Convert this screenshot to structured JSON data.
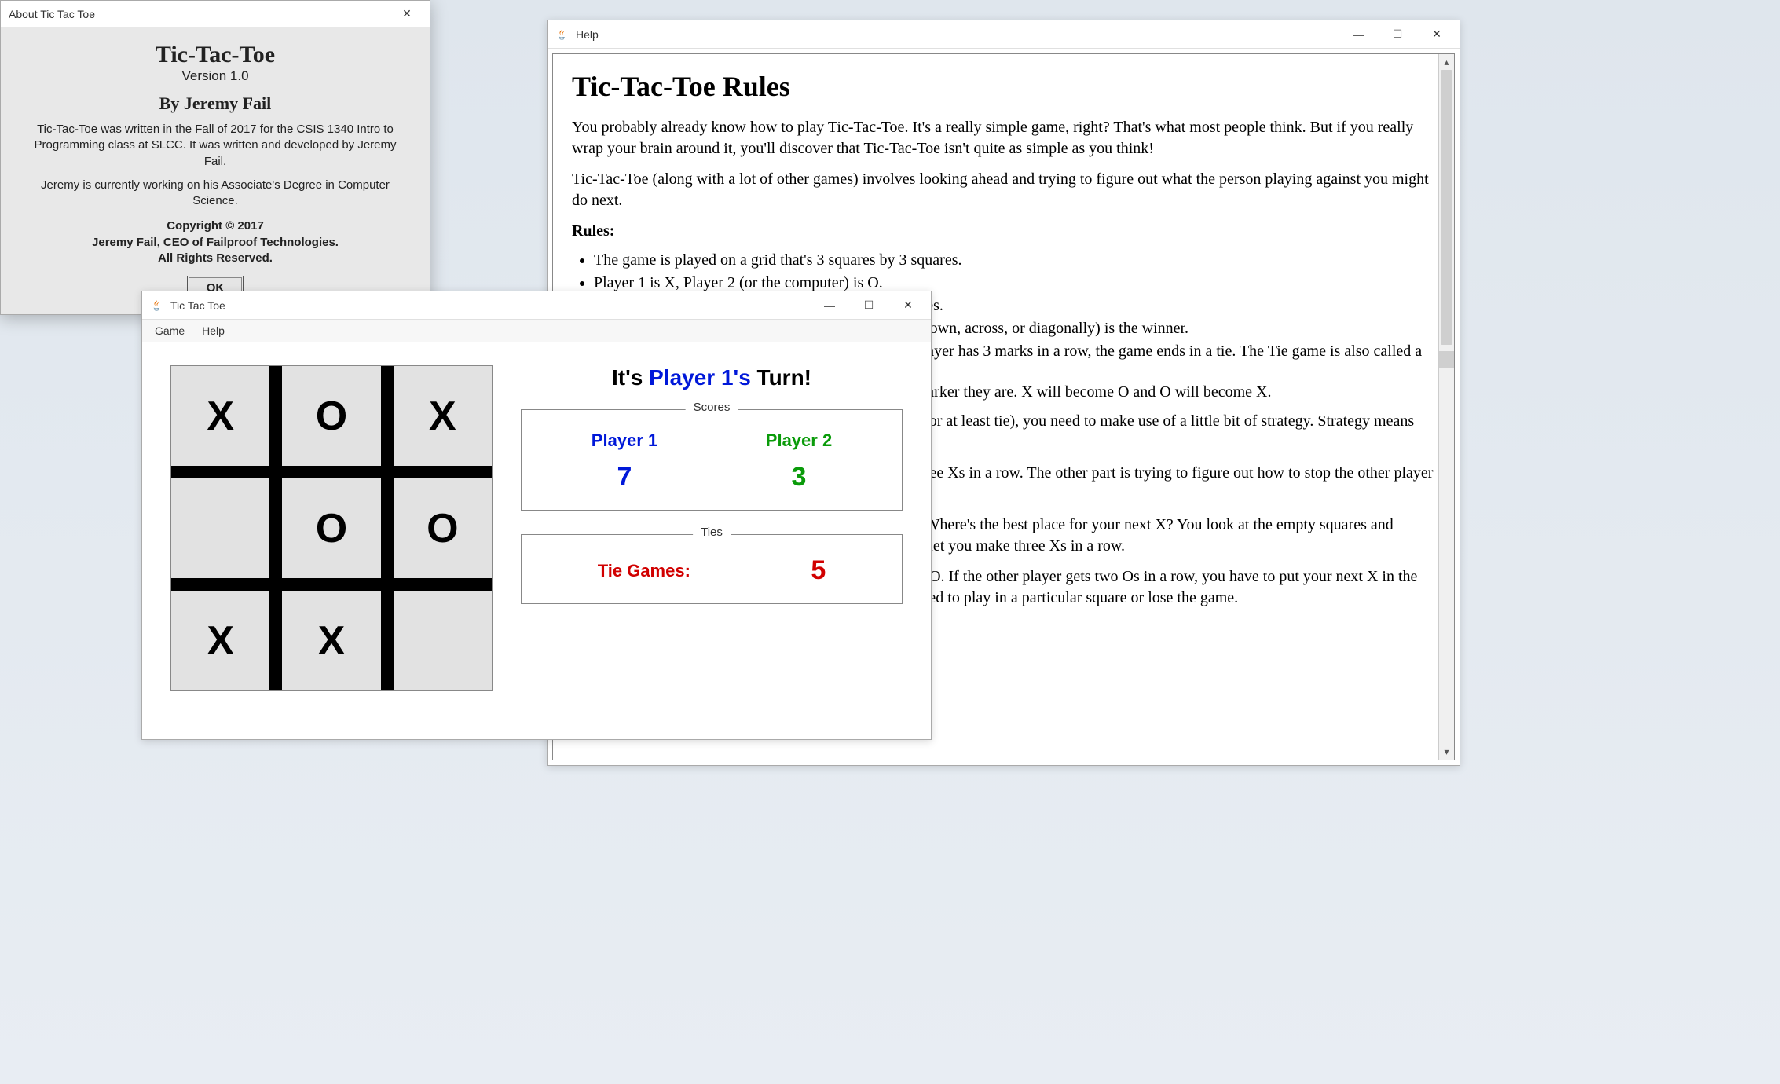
{
  "help_window": {
    "title": "Help",
    "heading": "Tic-Tac-Toe Rules",
    "p1": "You probably already know how to play Tic-Tac-Toe. It's a really simple game, right? That's what most people think. But if you really wrap your brain around it, you'll discover that Tic-Tac-Toe isn't quite as simple as you think!",
    "p2": "Tic-Tac-Toe (along with a lot of other games) involves looking ahead and trying to figure out what the person playing against you might do next.",
    "rules_label": "Rules:",
    "rules": [
      "The game is played on a grid that's 3 squares by 3 squares.",
      "Player 1 is X, Player 2 (or the computer) is O.",
      "Players take turns putting their marks in empty squares.",
      "The first player to get 3 of their marks in a row (up, down, across, or diagonally) is the winner.",
      "When all 9 squares are full, the game is over. If no player has 3 marks in a row, the game ends in a tie. The Tie game is also called a Cat Game.",
      "At the end of each game, the players will swap the marker they are. X will become O and O will become X."
    ],
    "strategy_p1": "Part of your strategy is trying to figure out how to get three Xs in a row. The other part is trying to figure out how to stop the other player from getting three Os in a row.",
    "strategy_p2": "After you put an X in a square, you start looking ahead. Where's the best place for your next X? You look at the empty squares and decide which ones are good choices—which ones might let you make three Xs in a row.",
    "strategy_p3": "You also have to watch where the other player puts their O. If the other player gets two Os in a row, you have to put your next X in the last empty square in that row, or they'll win. You are forced to play in a particular square or lose the game.",
    "strategy_intro": "How can I win at Tic-Tac-Toe? To beat the other player (or at least tie), you need to make use of a little bit of strategy. Strategy means figuring out what you need to do to win."
  },
  "game_window": {
    "title": "Tic Tac Toe",
    "menus": {
      "game": "Game",
      "help": "Help"
    },
    "turn_prefix": "It's ",
    "turn_player": "Player 1's",
    "turn_suffix": " Turn!",
    "scores_legend": "Scores",
    "ties_legend": "Ties",
    "p1_label": "Player 1",
    "p2_label": "Player 2",
    "p1_score": "7",
    "p2_score": "3",
    "ties_label": "Tie Games:",
    "ties_value": "5",
    "board": [
      "X",
      "O",
      "X",
      "",
      "O",
      "O",
      "X",
      "X",
      ""
    ]
  },
  "about_dialog": {
    "title": "About Tic Tac Toe",
    "app_name": "Tic-Tac-Toe",
    "version": "Version 1.0",
    "author": "By Jeremy Fail",
    "p1": "Tic-Tac-Toe was written in the Fall of 2017 for the CSIS 1340 Intro to Programming class at SLCC. It was written and developed by Jeremy Fail.",
    "p2": "Jeremy is currently working on his Associate's Degree in Computer Science.",
    "copy1": "Copyright © 2017",
    "copy2": "Jeremy Fail, CEO of Failproof Technologies.",
    "copy3": "All Rights Reserved.",
    "ok": "OK"
  }
}
